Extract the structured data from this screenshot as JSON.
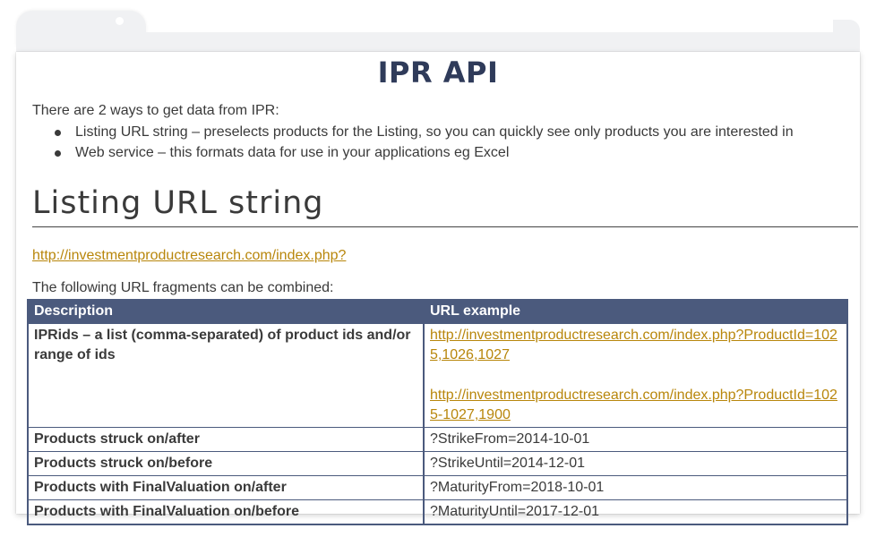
{
  "document": {
    "title": "IPR API",
    "intro": "There are 2 ways to get data from IPR:",
    "bullets": [
      "Listing URL string – preselects products for the Listing, so you can quickly see only products you are interested in",
      "Web service – this formats data for use in your applications eg Excel"
    ],
    "section_heading": "Listing URL string",
    "base_url": "http://investmentproductresearch.com/index.php?",
    "fragments_text": "The following URL fragments can be combined:",
    "table": {
      "headers": [
        "Description",
        "URL example"
      ],
      "rows": [
        {
          "description": "IPRids – a list (comma-separated) of product ids and/or range of ids",
          "links": [
            "http://investmentproductresearch.com/index.php?ProductId=1025,1026,1027",
            "http://investmentproductresearch.com/index.php?ProductId=1025-1027,1900"
          ]
        },
        {
          "description": "Products struck on/after",
          "example": "?StrikeFrom=2014-10-01"
        },
        {
          "description": "Products struck on/before",
          "example": "?StrikeUntil=2014-12-01"
        },
        {
          "description": "Products with FinalValuation on/after",
          "example": "?MaturityFrom=2018-10-01"
        },
        {
          "description": "Products with FinalValuation on/before",
          "example": "?MaturityUntil=2017-12-01"
        }
      ]
    }
  },
  "colors": {
    "title": "#2f3b5a",
    "table_header": "#4b5a7d",
    "link": "#b8860b",
    "text": "#3a3a3a"
  }
}
